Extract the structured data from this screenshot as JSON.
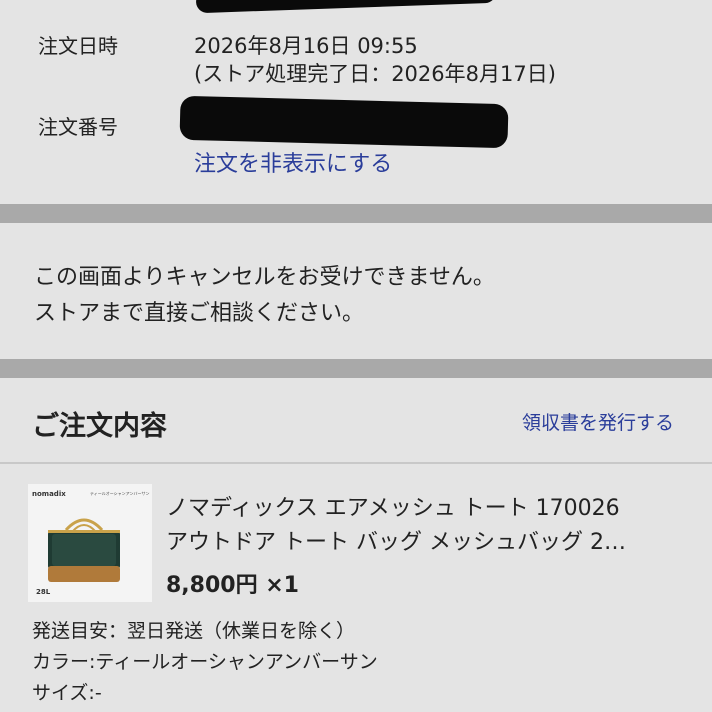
{
  "order_info": {
    "date_label": "注文日時",
    "date_value": "2026年8月16日 09:55",
    "store_completed": "(ストア処理完了日：2026年8月17日)",
    "number_label": "注文番号",
    "hide_order_link": "注文を非表示にする"
  },
  "notice": {
    "line1": "この画面よりキャンセルをお受けできません。",
    "line2": "ストアまで直接ご相談ください。"
  },
  "order_contents": {
    "heading": "ご注文内容",
    "receipt_link": "領収書を発行する",
    "item": {
      "title_line1": "ノマディックス エアメッシュ トート 170026",
      "title_line2": "アウトドア トート バッグ メッシュバッグ 2…",
      "price_qty": "8,800円 ×1",
      "thumb_brand": "nomadix",
      "thumb_caption": "ティールオーシャンアンバーサン",
      "thumb_size": "28L",
      "shipping": "発送目安：翌日発送（休業日を除く）",
      "color": "カラー:ティールオーシャンアンバーサン",
      "size": "サイズ:-"
    }
  },
  "colors": {
    "background": "#e4e4e4",
    "divider": "#a9a9a9",
    "link": "#2a3d9a",
    "text": "#222222"
  }
}
